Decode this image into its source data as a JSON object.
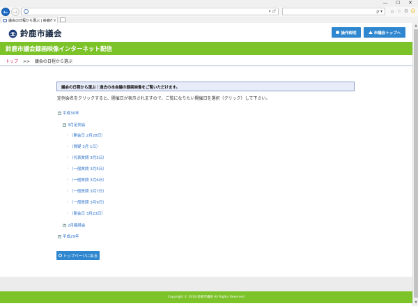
{
  "browser": {
    "tab_title": "議会の日程から選ぶ | 鈴鹿市...",
    "tab_close": "×",
    "window_controls": [
      "—",
      "☐",
      "✕"
    ],
    "address_controls": "▾ ♂",
    "search_controls": "ρ ▾",
    "toolbar_icons": [
      "⌂",
      "☆",
      "⚙",
      "☺"
    ]
  },
  "header": {
    "site_name": "鈴鹿市議会",
    "guide_button": "操作説明",
    "top_button": "市議会トップへ"
  },
  "banner": {
    "title": "鈴鹿市議会録画映像インターネット配信"
  },
  "breadcrumb": {
    "home": "トップ",
    "separator": ">>",
    "current": "議会の日程から選ぶ"
  },
  "main": {
    "info_heading": "議会の日程から選ぶ｜過去の本会議の録画映像をご覧いただけます。",
    "lead_text": "定例会名をクリックすると、開催日が表示されますので、ご覧になりたい開催日を選択（クリック）して下さい。",
    "tree": {
      "year1": {
        "toggle": "−",
        "label": "平成30年"
      },
      "session1": {
        "toggle": "−",
        "label": "3月定例会"
      },
      "days": [
        "（開会日 2月28日）",
        "（質疑 3月 1日）",
        "（代表質問 3月2日）",
        "（一般質問 3月5日）",
        "（一般質問 3月6日）",
        "（一般質問 3月7日）",
        "（一般質問 3月9日）",
        "（閉会日 3月23日）"
      ],
      "session2": {
        "toggle": "+",
        "label": "2月臨時会"
      },
      "year2": {
        "toggle": "+",
        "label": "平成29年"
      }
    },
    "back_button": "トップページに戻る"
  },
  "footer": {
    "copyright": "Copyright © 2018 鈴鹿市議会 All Rights Reserved"
  },
  "colors": {
    "accent_green": "#7cc229",
    "button_blue": "#2f87cf",
    "link_blue": "#2a6fc9",
    "crumb_red": "#d02050"
  }
}
